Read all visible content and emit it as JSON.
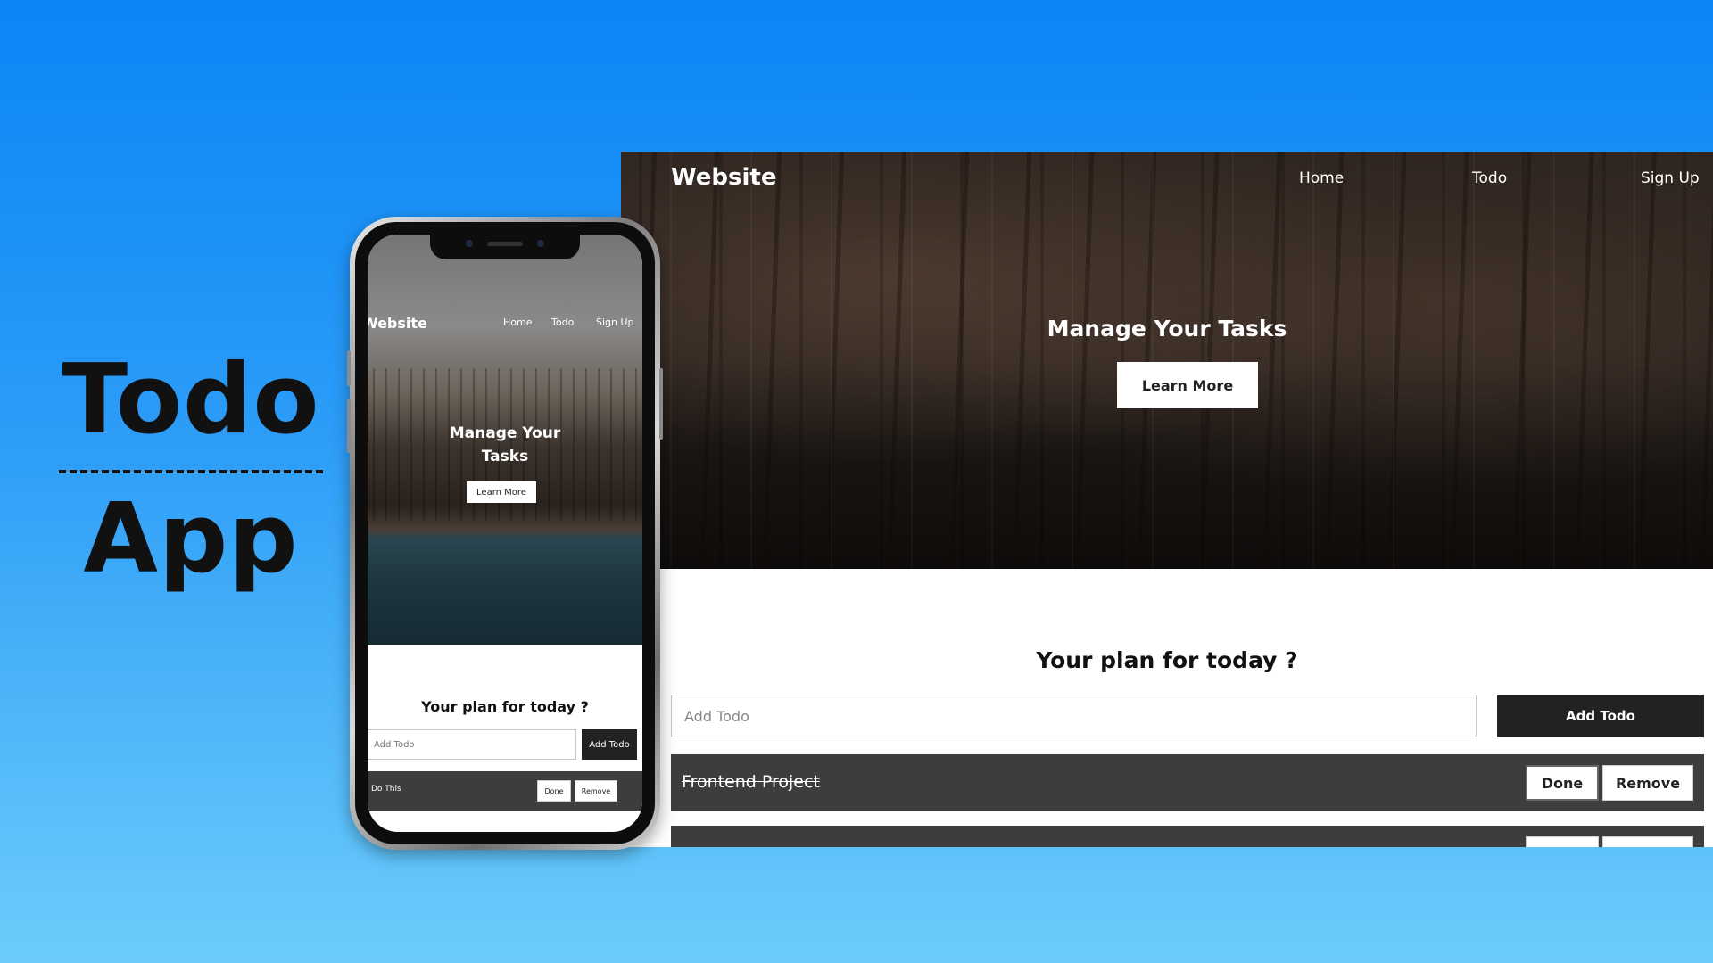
{
  "promo": {
    "word1": "Todo",
    "word2": "App"
  },
  "desktop": {
    "brand": "Website",
    "nav": [
      "Home",
      "Todo",
      "Sign Up"
    ],
    "hero_title": "Manage Your Tasks",
    "learn_more": "Learn More",
    "plan_heading": "Your plan for today ?",
    "input_placeholder": "Add Todo",
    "add_button": "Add Todo",
    "todos": [
      {
        "text": "Frontend Project",
        "completed": true,
        "done_label": "Done",
        "remove_label": "Remove"
      }
    ]
  },
  "phone": {
    "brand": "Website",
    "nav": [
      "Home",
      "Todo",
      "Sign Up"
    ],
    "hero_title_line1": "Manage Your",
    "hero_title_line2": "Tasks",
    "learn_more": "Learn More",
    "plan_heading": "Your plan for today ?",
    "input_placeholder": "Add Todo",
    "add_button": "Add Todo",
    "todos": [
      {
        "text": "Do This",
        "done_label": "Done",
        "remove_label": "Remove"
      }
    ]
  },
  "colors": {
    "background_top": "#0a86f7",
    "background_bottom": "#6ccdfb",
    "dark_button": "#222222",
    "todo_row": "#3d3d3d"
  }
}
